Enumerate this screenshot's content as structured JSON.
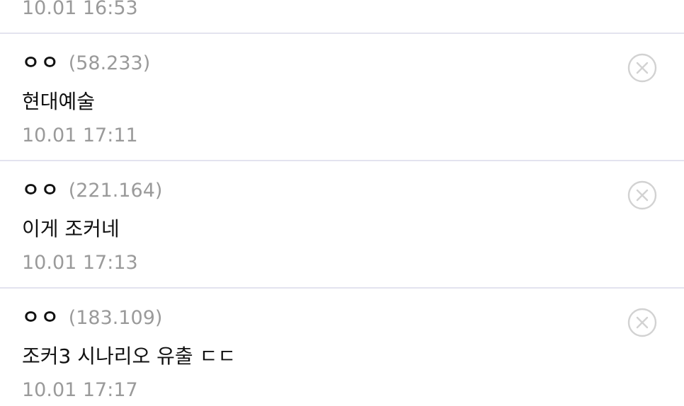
{
  "top_fragment": {
    "time": "10.01 16:53"
  },
  "comments": [
    {
      "nickname": "ㅇㅇ",
      "ip": "(58.233)",
      "text": "현대예술",
      "time": "10.01 17:11",
      "delete_icon": "circle-x-icon"
    },
    {
      "nickname": "ㅇㅇ",
      "ip": "(221.164)",
      "text": "이게 조커네",
      "time": "10.01 17:13",
      "delete_icon": "circle-x-icon"
    },
    {
      "nickname": "ㅇㅇ",
      "ip": "(183.109)",
      "text": "조커3 시나리오 유출 ㄷㄷ",
      "time": "10.01 17:17",
      "delete_icon": "circle-x-icon"
    }
  ],
  "colors": {
    "divider": "#e3e3ef",
    "muted_text": "#9a9a9a",
    "primary_text": "#111111",
    "icon_stroke": "#d2d2d2"
  }
}
